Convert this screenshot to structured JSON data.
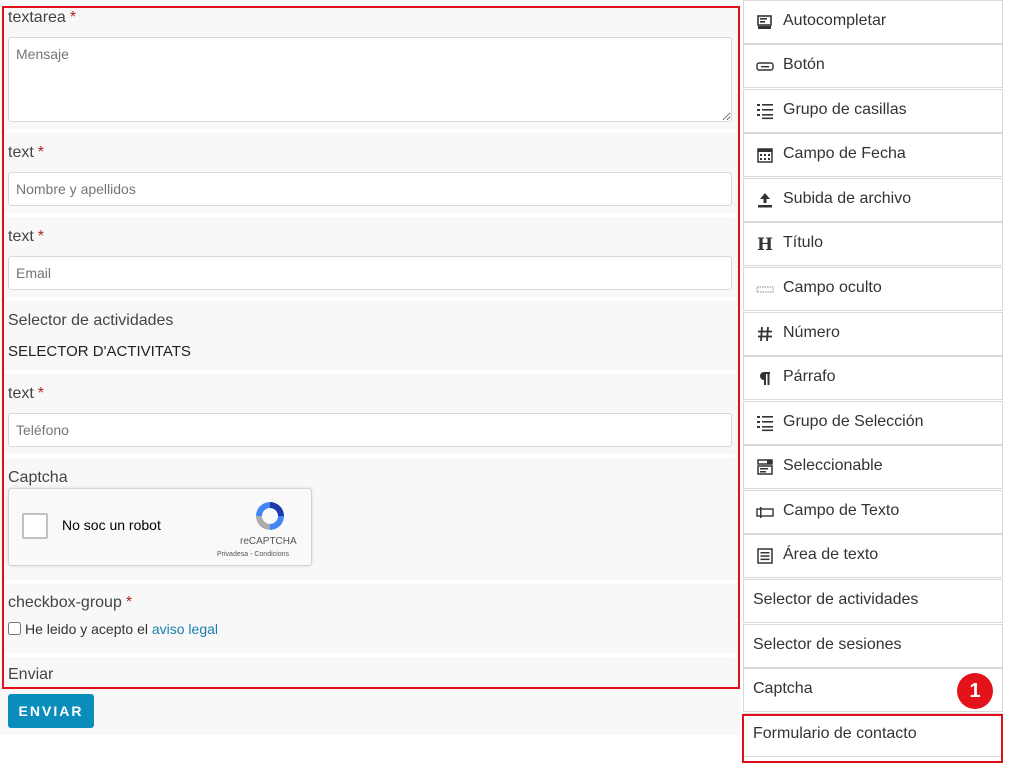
{
  "form": {
    "textarea": {
      "label": "textarea",
      "required_mark": "*",
      "placeholder": "Mensaje"
    },
    "name": {
      "label": "text",
      "required_mark": "*",
      "placeholder": "Nombre y apellidos"
    },
    "email": {
      "label": "text",
      "required_mark": "*",
      "placeholder": "Email"
    },
    "activities": {
      "label": "Selector de actividades",
      "value": "SELECTOR D'ACTIVITATS"
    },
    "phone": {
      "label": "text",
      "required_mark": "*",
      "placeholder": "Teléfono"
    },
    "captcha": {
      "label": "Captcha",
      "checkbox_text": "No soc un robot",
      "brand": "reCAPTCHA",
      "links": "Privadesa - Condicions"
    },
    "checkbox_group": {
      "label": "checkbox-group",
      "required_mark": "*",
      "text": "He leido y acepto el",
      "link": "aviso legal"
    },
    "submit_field": {
      "label": "Enviar"
    },
    "submit_button": "ENVIAR"
  },
  "palette": {
    "items": [
      {
        "label": "Autocompletar",
        "icon": "autocomplete-icon"
      },
      {
        "label": "Botón",
        "icon": "button-icon"
      },
      {
        "label": "Grupo de casillas",
        "icon": "checkbox-group-icon"
      },
      {
        "label": "Campo de Fecha",
        "icon": "calendar-icon"
      },
      {
        "label": "Subida de archivo",
        "icon": "upload-icon"
      },
      {
        "label": "Título",
        "icon": "heading-icon"
      },
      {
        "label": "Campo oculto",
        "icon": "hidden-field-icon"
      },
      {
        "label": "Número",
        "icon": "hash-icon"
      },
      {
        "label": "Párrafo",
        "icon": "paragraph-icon"
      },
      {
        "label": "Grupo de Selección",
        "icon": "radio-group-icon"
      },
      {
        "label": "Seleccionable",
        "icon": "select-icon"
      },
      {
        "label": "Campo de Texto",
        "icon": "text-field-icon"
      },
      {
        "label": "Área de texto",
        "icon": "textarea-icon"
      },
      {
        "label": "Selector de actividades"
      },
      {
        "label": "Selector de sesiones"
      },
      {
        "label": "Captcha"
      },
      {
        "label": "Formulario de contacto"
      }
    ]
  },
  "annotation": {
    "step_number": "1"
  },
  "colors": {
    "highlight": "#e0101a",
    "button": "#0b8dbc",
    "required": "#b0232a",
    "link": "#1a7fae"
  }
}
